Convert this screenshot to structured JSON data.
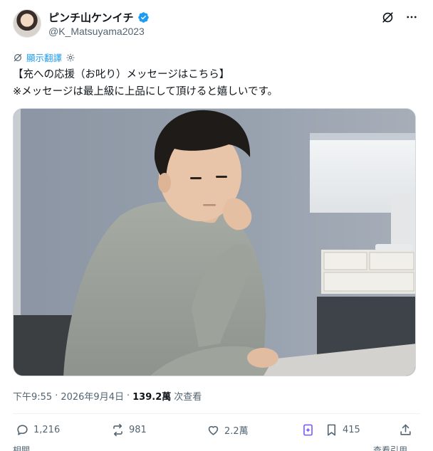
{
  "author": {
    "display_name": "ピンチ山ケンイチ",
    "handle": "@K_Matsuyama2023"
  },
  "translate": {
    "label": "顯示翻譯"
  },
  "tweet": {
    "lines": [
      "【充への応援（お叱り）メッセージはこちら】",
      "※メッセージは最上級に上品にして頂けると嬉しいです。"
    ]
  },
  "meta": {
    "time": "下午9:55",
    "date": "2026年9月4日",
    "views_count": "139.2萬",
    "views_label": "次查看"
  },
  "actions": {
    "replies": "1,216",
    "reposts": "981",
    "likes": "2.2萬",
    "bookmarks": "415"
  },
  "footer": {
    "left_cut": "相關",
    "right_cut": "查看引用"
  },
  "colors": {
    "accent": "#1d9bf0",
    "secondary_text": "#536471",
    "grok_purple": "#7856ff"
  }
}
